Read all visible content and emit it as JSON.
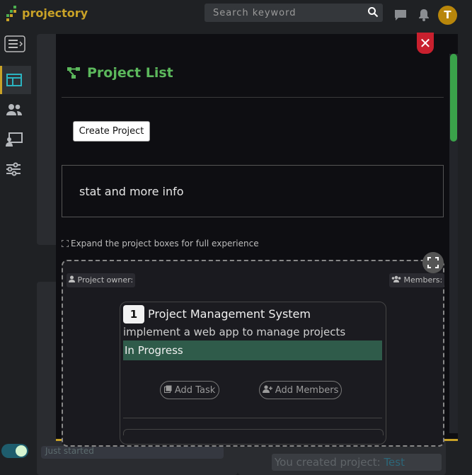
{
  "app": {
    "brand": "projectory"
  },
  "search": {
    "placeholder": "Search keyword"
  },
  "user": {
    "avatar_letter": "T"
  },
  "colors": {
    "accent": "#c9a227",
    "title_green": "#5cb85c",
    "close_red": "#c9202e",
    "status_green": "#2f5b4a"
  },
  "modal": {
    "title": "Project List",
    "create_button": "Create Project",
    "stat_text": "stat and more info",
    "expand_hint": "Expand the project boxes for full experience",
    "owner_label": "Project owner:",
    "members_label": "Members:",
    "close_symbol": "✕"
  },
  "project": {
    "number": "1",
    "name": "Project Management System",
    "description": "implement a web app to manage projects",
    "status": "In Progress",
    "add_task_label": "Add Task",
    "add_members_label": "Add Members"
  },
  "background": {
    "status_text": "Just started",
    "activity_prefix": "You created project:",
    "activity_link": "Test"
  }
}
